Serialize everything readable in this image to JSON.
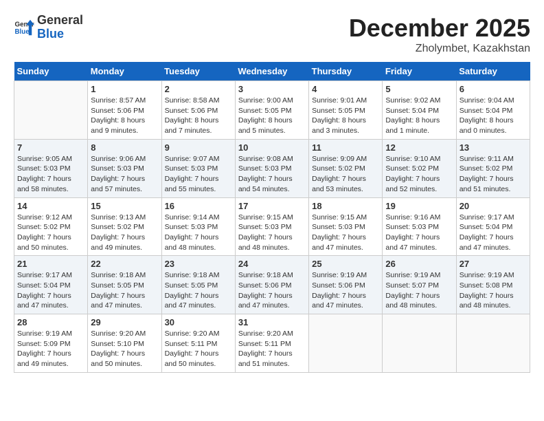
{
  "header": {
    "logo_general": "General",
    "logo_blue": "Blue",
    "month": "December 2025",
    "location": "Zholymbet, Kazakhstan"
  },
  "weekdays": [
    "Sunday",
    "Monday",
    "Tuesday",
    "Wednesday",
    "Thursday",
    "Friday",
    "Saturday"
  ],
  "rows": [
    [
      {
        "day": "",
        "text": ""
      },
      {
        "day": "1",
        "text": "Sunrise: 8:57 AM\nSunset: 5:06 PM\nDaylight: 8 hours\nand 9 minutes."
      },
      {
        "day": "2",
        "text": "Sunrise: 8:58 AM\nSunset: 5:06 PM\nDaylight: 8 hours\nand 7 minutes."
      },
      {
        "day": "3",
        "text": "Sunrise: 9:00 AM\nSunset: 5:05 PM\nDaylight: 8 hours\nand 5 minutes."
      },
      {
        "day": "4",
        "text": "Sunrise: 9:01 AM\nSunset: 5:05 PM\nDaylight: 8 hours\nand 3 minutes."
      },
      {
        "day": "5",
        "text": "Sunrise: 9:02 AM\nSunset: 5:04 PM\nDaylight: 8 hours\nand 1 minute."
      },
      {
        "day": "6",
        "text": "Sunrise: 9:04 AM\nSunset: 5:04 PM\nDaylight: 8 hours\nand 0 minutes."
      }
    ],
    [
      {
        "day": "7",
        "text": "Sunrise: 9:05 AM\nSunset: 5:03 PM\nDaylight: 7 hours\nand 58 minutes."
      },
      {
        "day": "8",
        "text": "Sunrise: 9:06 AM\nSunset: 5:03 PM\nDaylight: 7 hours\nand 57 minutes."
      },
      {
        "day": "9",
        "text": "Sunrise: 9:07 AM\nSunset: 5:03 PM\nDaylight: 7 hours\nand 55 minutes."
      },
      {
        "day": "10",
        "text": "Sunrise: 9:08 AM\nSunset: 5:03 PM\nDaylight: 7 hours\nand 54 minutes."
      },
      {
        "day": "11",
        "text": "Sunrise: 9:09 AM\nSunset: 5:02 PM\nDaylight: 7 hours\nand 53 minutes."
      },
      {
        "day": "12",
        "text": "Sunrise: 9:10 AM\nSunset: 5:02 PM\nDaylight: 7 hours\nand 52 minutes."
      },
      {
        "day": "13",
        "text": "Sunrise: 9:11 AM\nSunset: 5:02 PM\nDaylight: 7 hours\nand 51 minutes."
      }
    ],
    [
      {
        "day": "14",
        "text": "Sunrise: 9:12 AM\nSunset: 5:02 PM\nDaylight: 7 hours\nand 50 minutes."
      },
      {
        "day": "15",
        "text": "Sunrise: 9:13 AM\nSunset: 5:02 PM\nDaylight: 7 hours\nand 49 minutes."
      },
      {
        "day": "16",
        "text": "Sunrise: 9:14 AM\nSunset: 5:03 PM\nDaylight: 7 hours\nand 48 minutes."
      },
      {
        "day": "17",
        "text": "Sunrise: 9:15 AM\nSunset: 5:03 PM\nDaylight: 7 hours\nand 48 minutes."
      },
      {
        "day": "18",
        "text": "Sunrise: 9:15 AM\nSunset: 5:03 PM\nDaylight: 7 hours\nand 47 minutes."
      },
      {
        "day": "19",
        "text": "Sunrise: 9:16 AM\nSunset: 5:03 PM\nDaylight: 7 hours\nand 47 minutes."
      },
      {
        "day": "20",
        "text": "Sunrise: 9:17 AM\nSunset: 5:04 PM\nDaylight: 7 hours\nand 47 minutes."
      }
    ],
    [
      {
        "day": "21",
        "text": "Sunrise: 9:17 AM\nSunset: 5:04 PM\nDaylight: 7 hours\nand 47 minutes."
      },
      {
        "day": "22",
        "text": "Sunrise: 9:18 AM\nSunset: 5:05 PM\nDaylight: 7 hours\nand 47 minutes."
      },
      {
        "day": "23",
        "text": "Sunrise: 9:18 AM\nSunset: 5:05 PM\nDaylight: 7 hours\nand 47 minutes."
      },
      {
        "day": "24",
        "text": "Sunrise: 9:18 AM\nSunset: 5:06 PM\nDaylight: 7 hours\nand 47 minutes."
      },
      {
        "day": "25",
        "text": "Sunrise: 9:19 AM\nSunset: 5:06 PM\nDaylight: 7 hours\nand 47 minutes."
      },
      {
        "day": "26",
        "text": "Sunrise: 9:19 AM\nSunset: 5:07 PM\nDaylight: 7 hours\nand 48 minutes."
      },
      {
        "day": "27",
        "text": "Sunrise: 9:19 AM\nSunset: 5:08 PM\nDaylight: 7 hours\nand 48 minutes."
      }
    ],
    [
      {
        "day": "28",
        "text": "Sunrise: 9:19 AM\nSunset: 5:09 PM\nDaylight: 7 hours\nand 49 minutes."
      },
      {
        "day": "29",
        "text": "Sunrise: 9:20 AM\nSunset: 5:10 PM\nDaylight: 7 hours\nand 50 minutes."
      },
      {
        "day": "30",
        "text": "Sunrise: 9:20 AM\nSunset: 5:11 PM\nDaylight: 7 hours\nand 50 minutes."
      },
      {
        "day": "31",
        "text": "Sunrise: 9:20 AM\nSunset: 5:11 PM\nDaylight: 7 hours\nand 51 minutes."
      },
      {
        "day": "",
        "text": ""
      },
      {
        "day": "",
        "text": ""
      },
      {
        "day": "",
        "text": ""
      }
    ]
  ]
}
